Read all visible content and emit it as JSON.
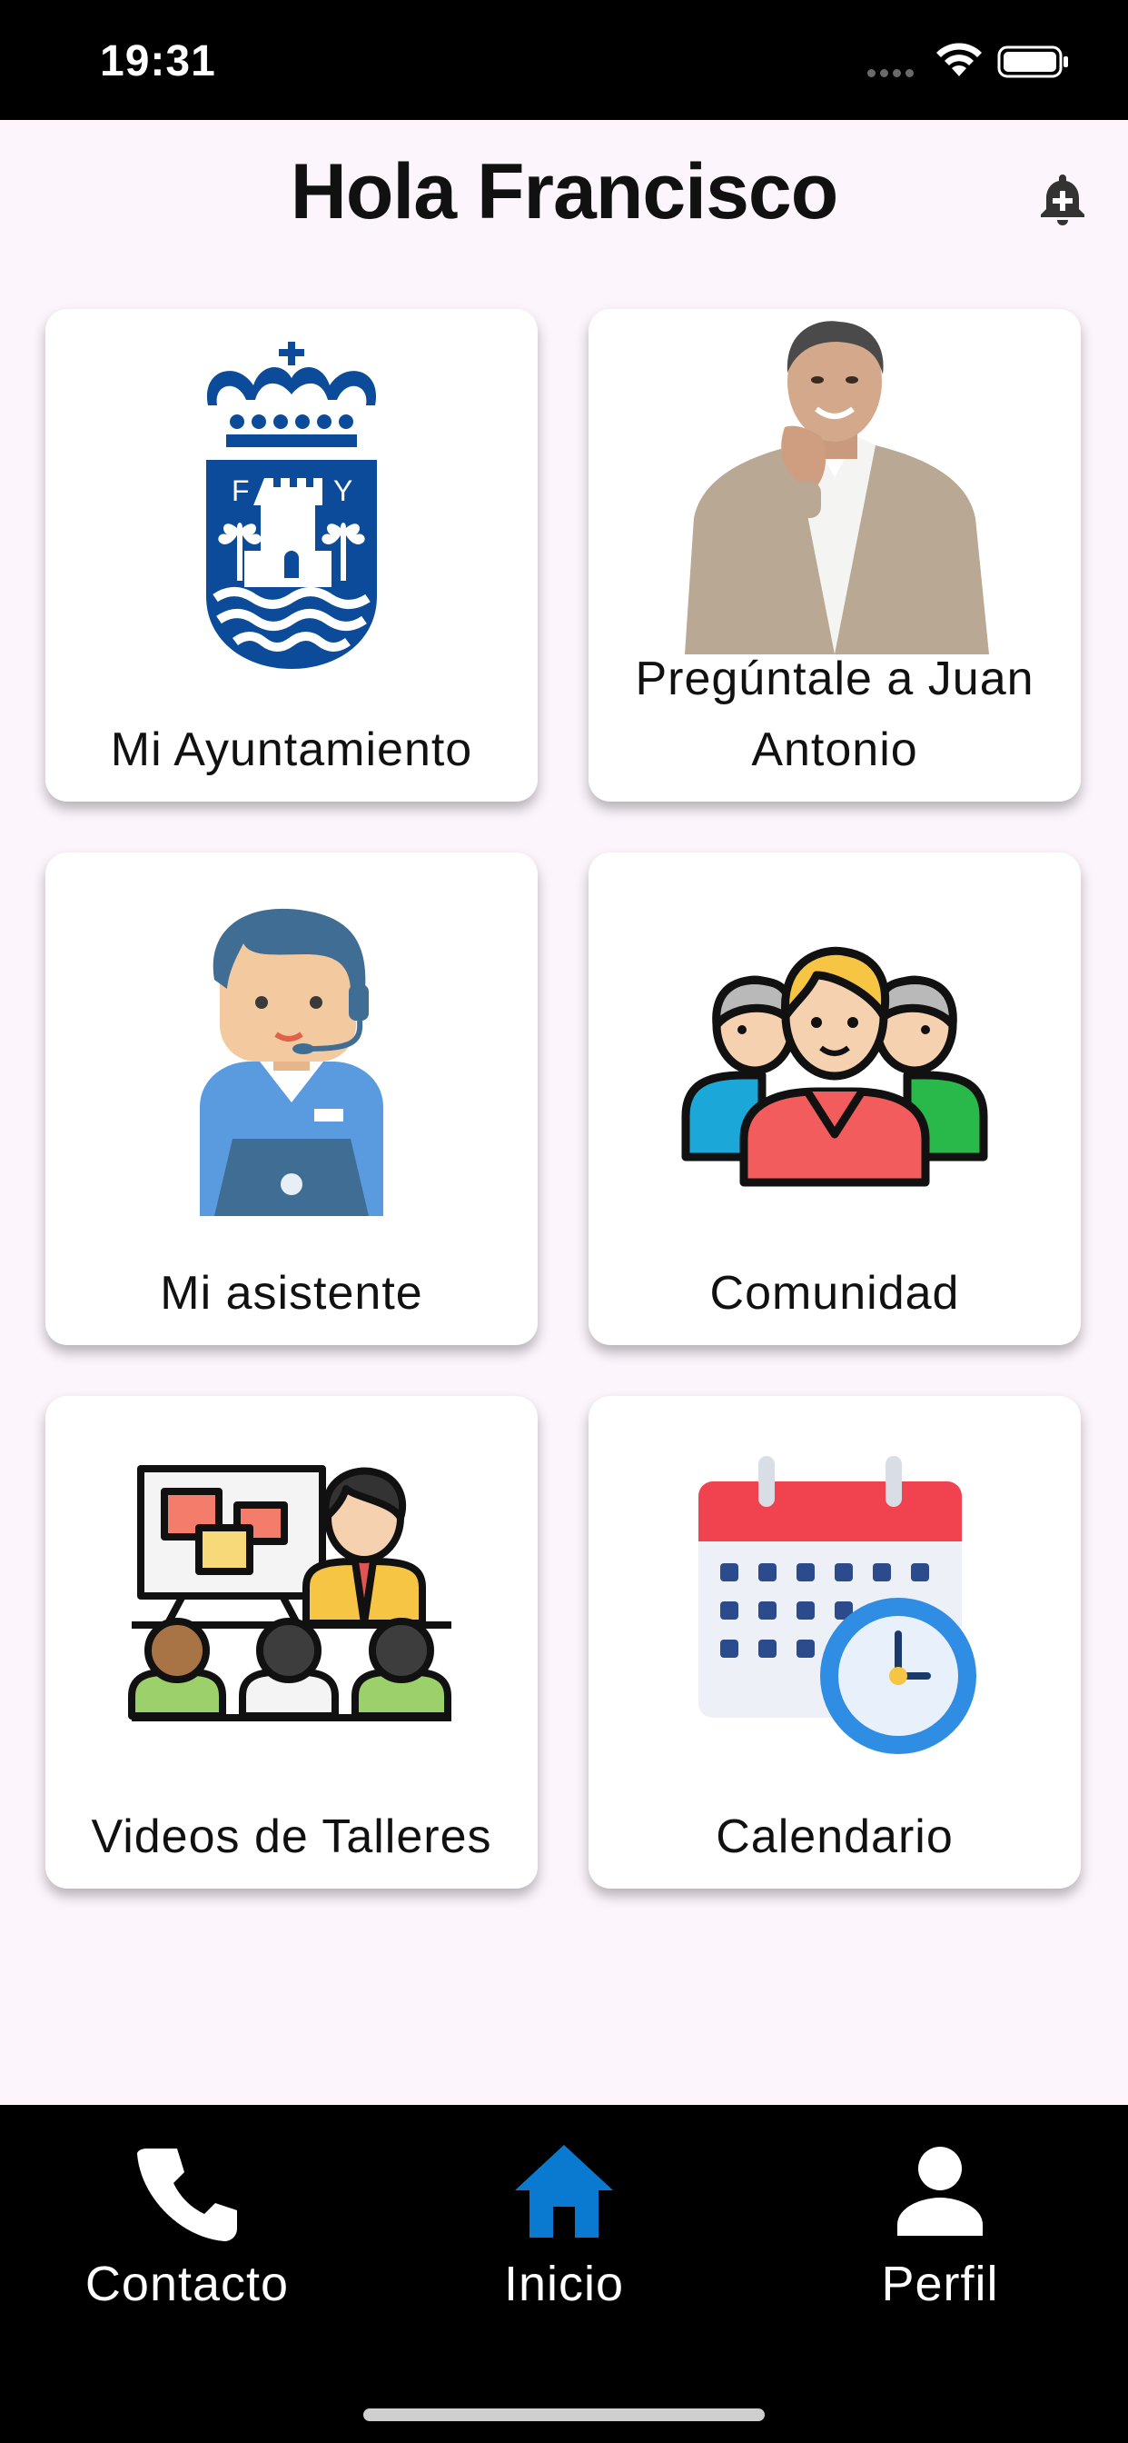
{
  "status_bar": {
    "time": "19:31"
  },
  "header": {
    "title": "Hola Francisco",
    "icon": "notification-add-icon"
  },
  "tiles": [
    {
      "label": "Mi Ayuntamiento",
      "icon": "coat-of-arms-icon",
      "crest_letters": [
        "F",
        "Y"
      ]
    },
    {
      "label_line1": "Pregúntale a Juan",
      "label_line2": "Antonio",
      "icon": "portrait-photo"
    },
    {
      "label": "Mi asistente",
      "icon": "support-agent-icon"
    },
    {
      "label": "Comunidad",
      "icon": "community-icon"
    },
    {
      "label": "Videos de Talleres",
      "icon": "workshop-icon"
    },
    {
      "label": "Calendario",
      "icon": "calendar-clock-icon"
    }
  ],
  "nav": {
    "items": [
      {
        "label": "Contacto",
        "icon": "phone-icon"
      },
      {
        "label": "Inicio",
        "icon": "home-icon",
        "active": true
      },
      {
        "label": "Perfil",
        "icon": "person-icon"
      }
    ],
    "active_color": "#1a73e8"
  },
  "colors": {
    "background": "#fcf5fc",
    "crest_blue": "#0b4b9a",
    "calendar_red": "#f0424f",
    "clock_blue": "#2f8de4"
  }
}
